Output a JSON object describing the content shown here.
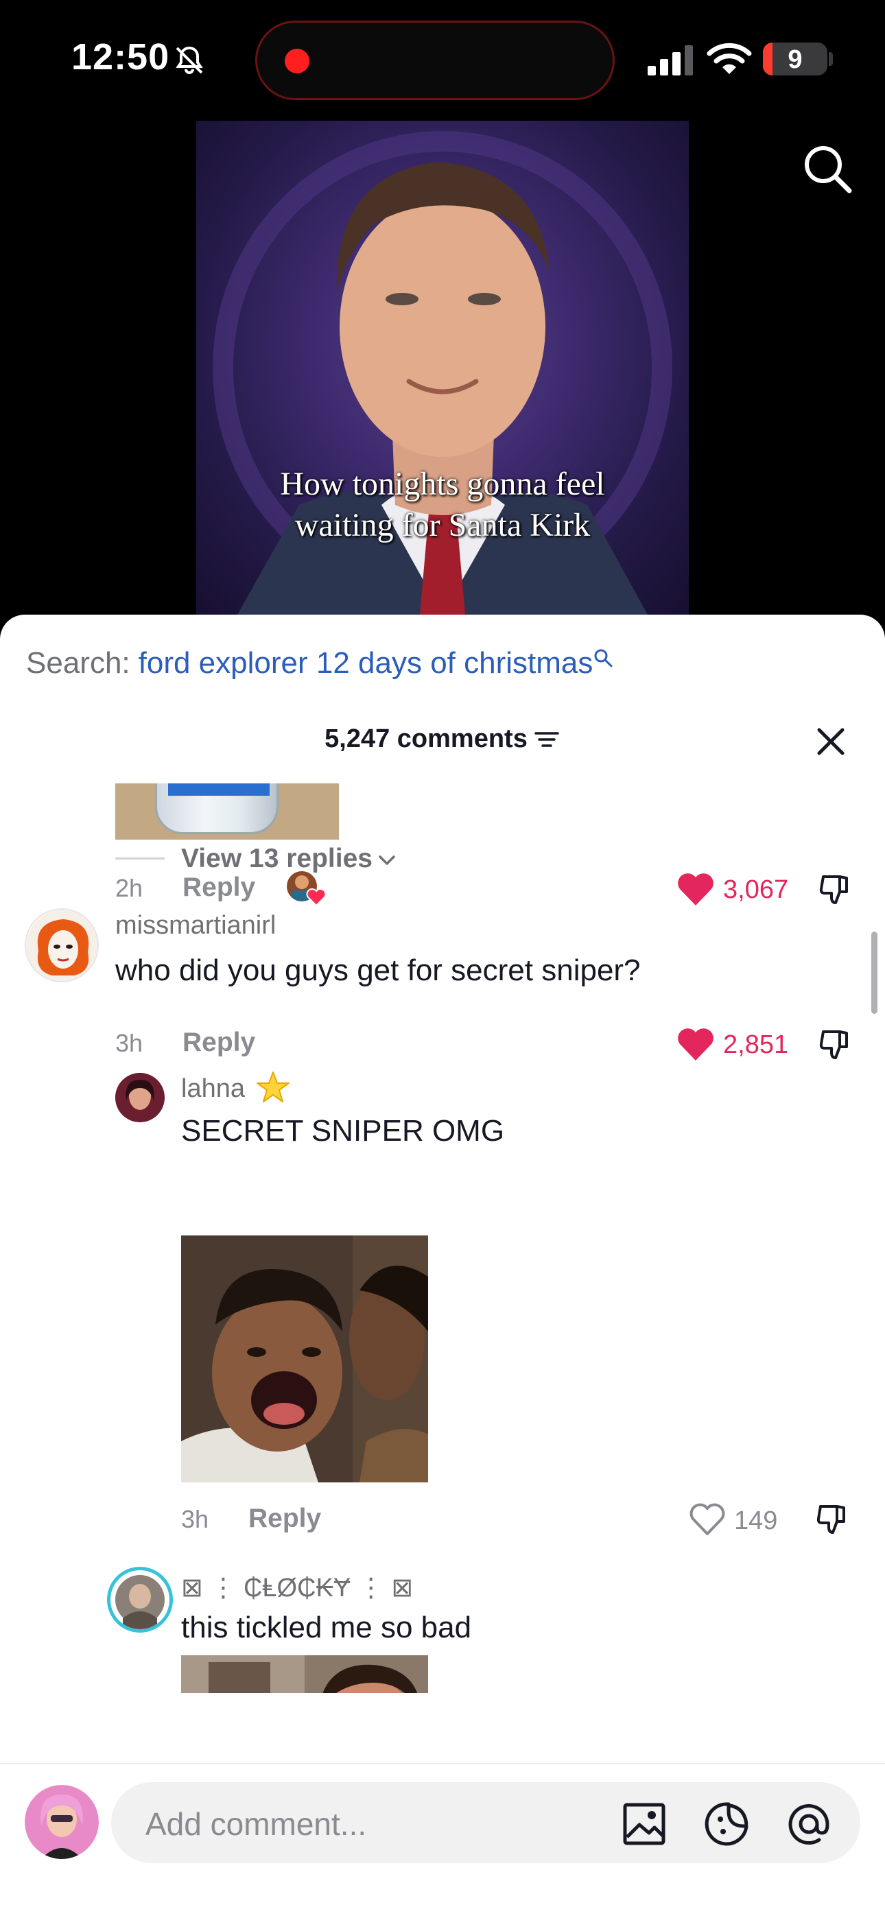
{
  "status_bar": {
    "time": "12:50",
    "battery": "9",
    "colors": {
      "recording": "#ff1f1f",
      "battery_low": "#ff3b30"
    }
  },
  "video": {
    "caption_line1": "How tonights gonna feel",
    "caption_line2": "waiting for Santa Kirk"
  },
  "sheet": {
    "search_prefix": "Search:",
    "search_query": "ford explorer 12 days of christmas",
    "comment_count": "5,247 comments"
  },
  "comments": {
    "first": {
      "age": "2h",
      "reply_label": "Reply",
      "likes": "3,067",
      "liked": true,
      "view_replies": "View 13 replies"
    },
    "second": {
      "username": "missmartianirl",
      "text": "who did you guys get for secret sniper?",
      "age": "3h",
      "reply_label": "Reply",
      "likes": "2,851",
      "liked": true
    },
    "replies": [
      {
        "username": "lahna",
        "badge": "star-icon",
        "text": "SECRET SNIPER OMG",
        "age": "3h",
        "reply_label": "Reply",
        "likes": "149",
        "liked": false
      },
      {
        "username": "⊠ ⋮ ₵ⱠØ₵₭Ɏ ⋮ ⊠",
        "text": "this tickled me so bad"
      }
    ]
  },
  "composer": {
    "placeholder": "Add comment..."
  },
  "colors": {
    "like_active": "#e3265b",
    "link_blue": "#2b5db9",
    "muted_text": "#8a8b91"
  }
}
